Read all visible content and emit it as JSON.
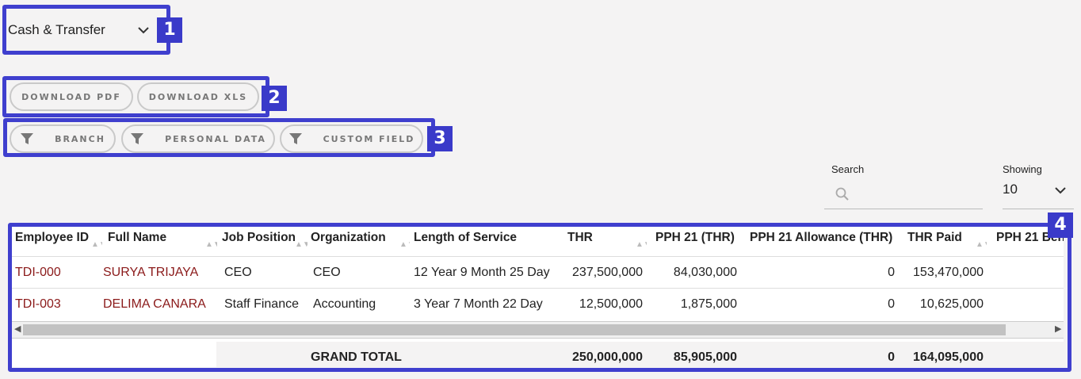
{
  "dropdown": {
    "value": "Cash & Transfer"
  },
  "downloads": {
    "pdf_label": "DOWNLOAD PDF",
    "xls_label": "DOWNLOAD XLS"
  },
  "filters": {
    "branch_label": "BRANCH",
    "personal_label": "PERSONAL DATA",
    "custom_label": "CUSTOM FIELD"
  },
  "search": {
    "label": "Search",
    "placeholder": ""
  },
  "showing": {
    "label": "Showing",
    "value": "10"
  },
  "annotations": [
    "1",
    "2",
    "3",
    "4"
  ],
  "table": {
    "headers": [
      "Employee ID",
      "Full Name",
      "Job Position",
      "Organization",
      "Length of Service",
      "THR",
      "PPH 21 (THR)",
      "PPH 21 Allowance (THR)",
      "THR Paid",
      "PPH 21 Ben"
    ],
    "rows": [
      [
        "TDI-000",
        "SURYA TRIJAYA",
        "CEO",
        "CEO",
        "12 Year 9 Month 25 Day",
        "237,500,000",
        "84,030,000",
        "0",
        "153,470,000",
        ""
      ],
      [
        "TDI-003",
        "DELIMA CANARA",
        "Staff Finance",
        "Accounting",
        "3 Year 7 Month 22 Day",
        "12,500,000",
        "1,875,000",
        "0",
        "10,625,000",
        ""
      ]
    ],
    "total": {
      "label": "GRAND TOTAL",
      "thr": "250,000,000",
      "pph21": "85,905,000",
      "allowance": "0",
      "paid": "164,095,000"
    }
  },
  "colors": {
    "annotation": "#3f3fce",
    "link_red": "#8b1a1a",
    "background": "#f4f3f3"
  }
}
